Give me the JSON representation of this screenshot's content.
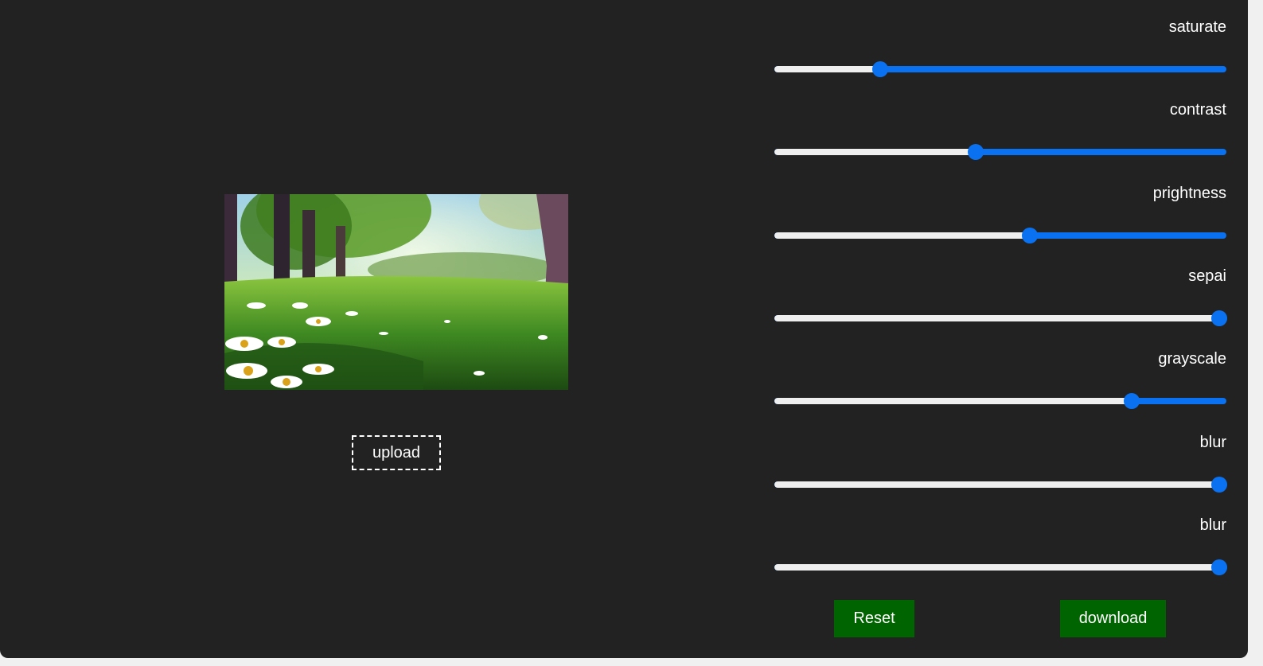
{
  "preview": {
    "image": "meadow-with-daisies-and-trees"
  },
  "upload": {
    "label": "upload"
  },
  "filters": [
    {
      "label": "saturate",
      "value": 0.235
    },
    {
      "label": "contrast",
      "value": 0.445
    },
    {
      "label": "prightness",
      "value": 0.565
    },
    {
      "label": "sepai",
      "value": 0.985
    },
    {
      "label": "grayscale",
      "value": 0.79
    },
    {
      "label": "blur",
      "value": 0.985
    },
    {
      "label": "blur",
      "value": 0.985
    }
  ],
  "actions": {
    "reset_label": "Reset",
    "download_label": "download"
  },
  "colors": {
    "background": "#222222",
    "slider_accent": "#0a72f0",
    "slider_track": "#efefef",
    "button": "#006400",
    "text": "#ffffff"
  }
}
